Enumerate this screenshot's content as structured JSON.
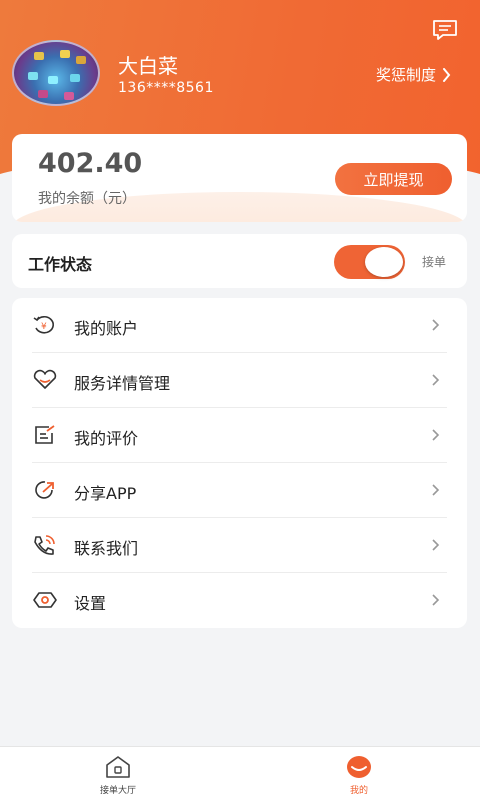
{
  "header": {
    "username": "大白菜",
    "phone": "136****8561",
    "reward_link": "奖惩制度"
  },
  "balance": {
    "amount": "402.40",
    "label": "我的余额（元）",
    "withdraw_button": "立即提现"
  },
  "work_status": {
    "title": "工作状态",
    "toggle_on": true,
    "toggle_label": "接单"
  },
  "menu": {
    "items": [
      {
        "label": "我的账户",
        "icon": "wallet-yuan-icon"
      },
      {
        "label": "服务详情管理",
        "icon": "heart-icon"
      },
      {
        "label": "我的评价",
        "icon": "edit-note-icon"
      },
      {
        "label": "分享APP",
        "icon": "share-icon"
      },
      {
        "label": "联系我们",
        "icon": "phone-call-icon"
      },
      {
        "label": "设置",
        "icon": "settings-hexagon-icon"
      }
    ]
  },
  "tabbar": {
    "tabs": [
      {
        "label": "接单大厅",
        "icon": "home-icon",
        "active": false
      },
      {
        "label": "我的",
        "icon": "profile-icon",
        "active": true
      }
    ]
  },
  "colors": {
    "accent": "#ef6435",
    "header_start": "#ee7a3c",
    "header_end": "#f2632e",
    "background": "#f3f4f6"
  }
}
